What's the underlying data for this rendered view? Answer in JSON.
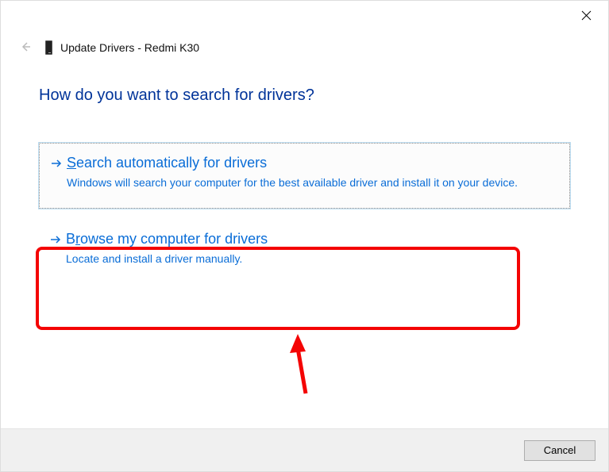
{
  "header": {
    "title": "Update Drivers - Redmi K30"
  },
  "heading": "How do you want to search for drivers?",
  "options": [
    {
      "accel": "S",
      "title_rest": "earch automatically for drivers",
      "desc": "Windows will search your computer for the best available driver and install it on your device."
    },
    {
      "accel_pre": "B",
      "accel": "r",
      "title_rest": "owse my computer for drivers",
      "desc": "Locate and install a driver manually."
    }
  ],
  "footer": {
    "cancel_label": "Cancel"
  }
}
